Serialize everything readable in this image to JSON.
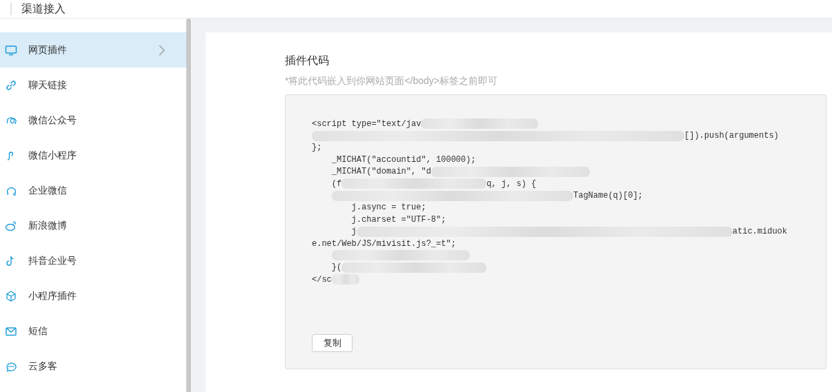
{
  "header": {
    "title": "渠道接入"
  },
  "sidebar": {
    "items": [
      {
        "label": "网页插件",
        "selected": true
      },
      {
        "label": "聊天链接",
        "selected": false
      },
      {
        "label": "微信公众号",
        "selected": false
      },
      {
        "label": "微信小程序",
        "selected": false
      },
      {
        "label": "企业微信",
        "selected": false
      },
      {
        "label": "新浪微博",
        "selected": false
      },
      {
        "label": "抖音企业号",
        "selected": false
      },
      {
        "label": "小程序插件",
        "selected": false
      },
      {
        "label": "短信",
        "selected": false
      },
      {
        "label": "云多客",
        "selected": false
      }
    ]
  },
  "panel": {
    "title": "插件代码",
    "hint": "*将此代码嵌入到你网站页面</body>标签之前即可",
    "code_lines": [
      [
        {
          "kind": "text",
          "text": "<script type=\"text/jav"
        },
        {
          "kind": "blur"
        }
      ],
      [
        {
          "kind": "blur"
        },
        {
          "kind": "text",
          "text": "[]).push(arguments)"
        }
      ],
      [
        {
          "kind": "text",
          "text": "};"
        }
      ],
      [
        {
          "kind": "text",
          "text": "    _MICHAT(\"accountid\", 100000);"
        }
      ],
      [
        {
          "kind": "text",
          "text": "    _MICHAT(\"domain\", \"d"
        },
        {
          "kind": "blur"
        }
      ],
      [
        {
          "kind": "text",
          "text": "    (f"
        },
        {
          "kind": "blur"
        },
        {
          "kind": "text",
          "text": "q, j, s) {"
        }
      ],
      [
        {
          "kind": "blur"
        },
        {
          "kind": "text",
          "text": "TagName(q)[0];"
        }
      ],
      [
        {
          "kind": "text",
          "text": "        j.async = true;"
        }
      ],
      [
        {
          "kind": "text",
          "text": "        j.charset =\"UTF-8\";"
        }
      ],
      [
        {
          "kind": "text",
          "text": "        j"
        },
        {
          "kind": "blur"
        },
        {
          "kind": "text",
          "text": "atic.miduok"
        }
      ],
      [
        {
          "kind": "text",
          "text": "e.net/Web/JS/mivisit.js?_=t\";"
        }
      ],
      [
        {
          "kind": "blur"
        }
      ],
      [
        {
          "kind": "text",
          "text": "    }("
        },
        {
          "kind": "blur"
        }
      ],
      [
        {
          "kind": "text",
          "text": "</sc"
        },
        {
          "kind": "blur"
        }
      ]
    ],
    "copy_button": "复制"
  }
}
